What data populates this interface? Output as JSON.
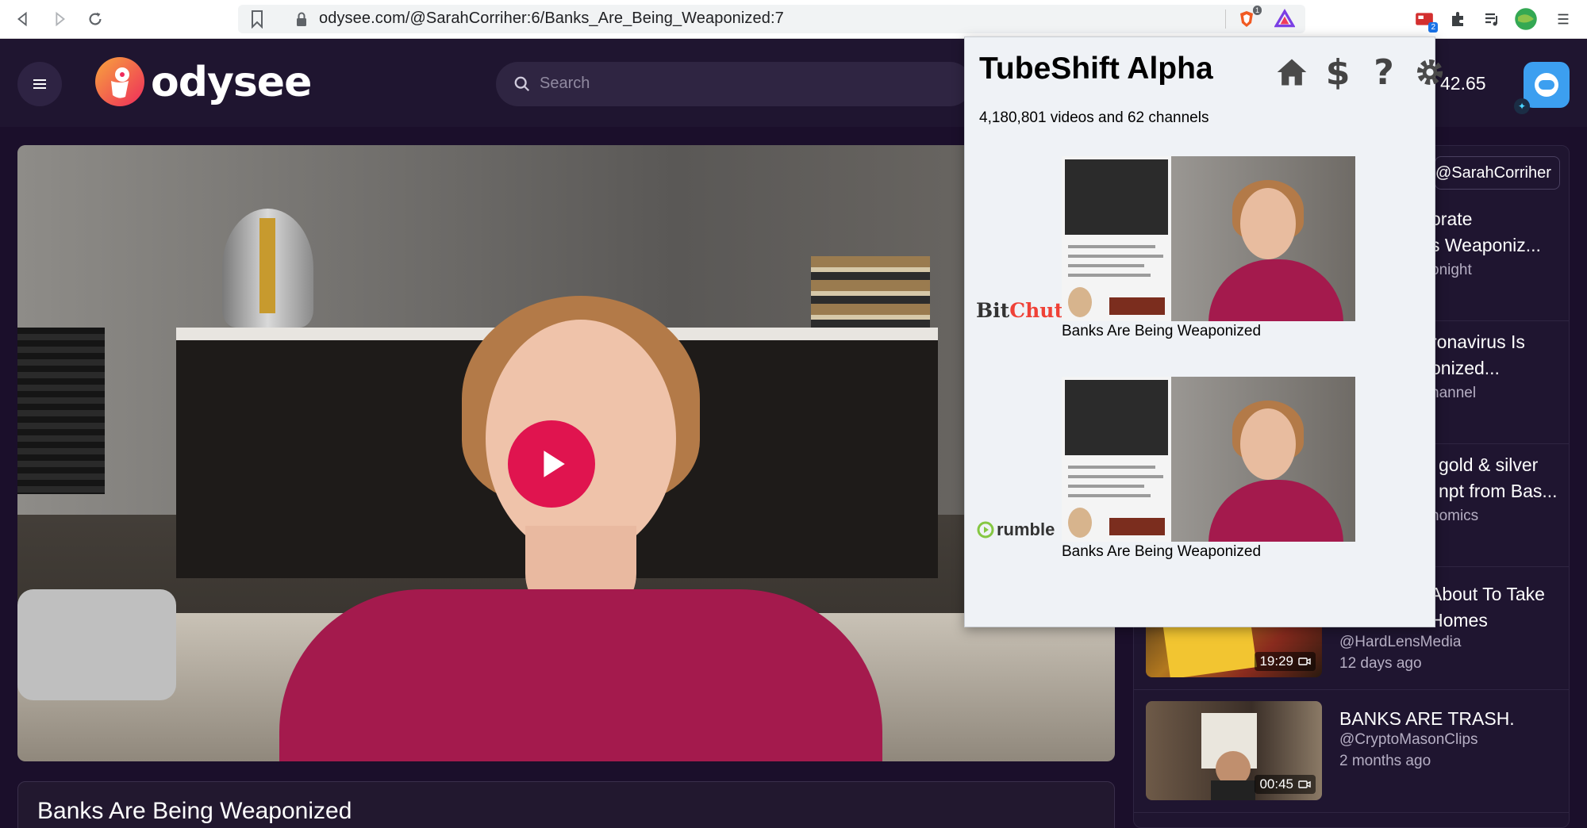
{
  "browser": {
    "url": "odysee.com/@SarahCorriher:6/Banks_Are_Being_Weaponized:7",
    "brave_shield_count": "1",
    "tubeshift_badge": "2"
  },
  "header": {
    "logo_text": "odysee",
    "search_placeholder": "Search",
    "credits": "42.65"
  },
  "video": {
    "title": "Banks Are Being Weaponized"
  },
  "sidebar": {
    "channel_chip": "@SarahCorriher",
    "items": [
      {
        "title_l1": "orate",
        "title_l2": "s Weaponiz...",
        "meta": "onight"
      },
      {
        "title_l1": "ronavirus Is",
        "title_l2": "onized...",
        "meta": "hannel"
      },
      {
        "title_l1": "gold & silver",
        "title_l2": "npt from Bas...",
        "meta": "nomics"
      },
      {
        "title_l1": "About To Take",
        "title_l2": "Homes",
        "channel": "@HardLensMedia",
        "date": "12 days ago",
        "duration": "19:29"
      },
      {
        "title_l1": "BANKS ARE TRASH.",
        "channel": "@CryptoMasonClips",
        "date": "2 months ago",
        "duration": "00:45"
      }
    ]
  },
  "popup": {
    "title": "TubeShift Alpha",
    "count": "4,180,801 videos and 62 channels",
    "icons": [
      "home-icon",
      "dollar-icon",
      "help-icon",
      "settings-icon"
    ],
    "results": [
      {
        "platform": "BitChute",
        "platform_part1": "Bit",
        "platform_part2": "Chute",
        "title": "Banks Are Being Weaponized"
      },
      {
        "platform": "rumble",
        "title": "Banks Are Being Weaponized"
      }
    ]
  },
  "colors": {
    "odysee_bg": "#1f1530",
    "play_button": "#e0144f",
    "popup_bg": "#eff2f6",
    "shirt": "#a41a4d"
  }
}
